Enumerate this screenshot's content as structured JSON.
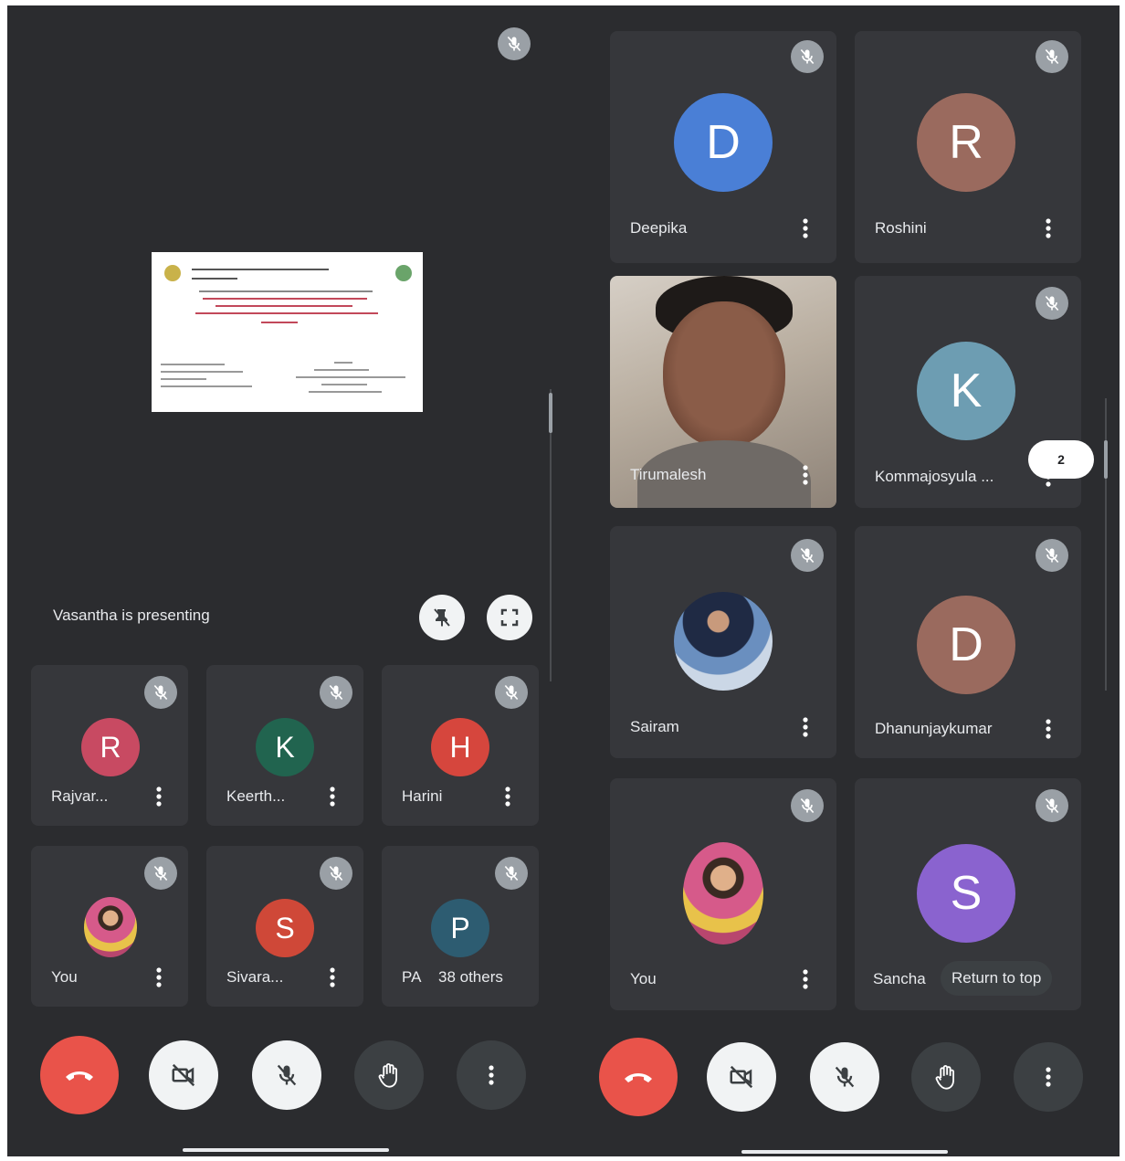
{
  "left_screen": {
    "presentation_banner": "Vasantha is presenting",
    "participants": [
      {
        "name": "Rajvar...",
        "initial": "R",
        "color": "#c84a62"
      },
      {
        "name": "Keerth...",
        "initial": "K",
        "color": "#21644f"
      },
      {
        "name": "Harini",
        "initial": "H",
        "color": "#d6463d"
      },
      {
        "name": "You",
        "initial": "",
        "color": ""
      },
      {
        "name": "Sivara...",
        "initial": "S",
        "color": "#cf4838"
      },
      {
        "name": "PA",
        "initial": "P",
        "color": "#2d5c71",
        "overflow_label": "38 others"
      }
    ]
  },
  "right_screen": {
    "participants": [
      {
        "name": "Deepika",
        "initial": "D",
        "color": "#4a7fd6"
      },
      {
        "name": "Roshini",
        "initial": "R",
        "color": "#9a6a5e"
      },
      {
        "name": "Tirumalesh",
        "initial": "",
        "color": ""
      },
      {
        "name": "Kommajosyula ...",
        "initial": "K",
        "color": "#6d9db2"
      },
      {
        "name": "Sairam",
        "initial": "",
        "color": ""
      },
      {
        "name": "Dhanunjaykumar",
        "initial": "D",
        "color": "#9a6a5e"
      },
      {
        "name": "You",
        "initial": "",
        "color": ""
      },
      {
        "name": "Sancha",
        "initial": "S",
        "color": "#8a63cf"
      }
    ],
    "page_badge": "2",
    "return_to_top": "Return to top"
  },
  "colors": {
    "background": "#2b2c2f",
    "tile": "#36373b",
    "end_call": "#e9534a",
    "button_light": "#f1f3f4"
  },
  "icons": [
    "mic-off-icon",
    "more-vert-icon",
    "pin-off-icon",
    "fullscreen-icon",
    "end-call-icon",
    "camera-off-icon",
    "raise-hand-icon"
  ]
}
